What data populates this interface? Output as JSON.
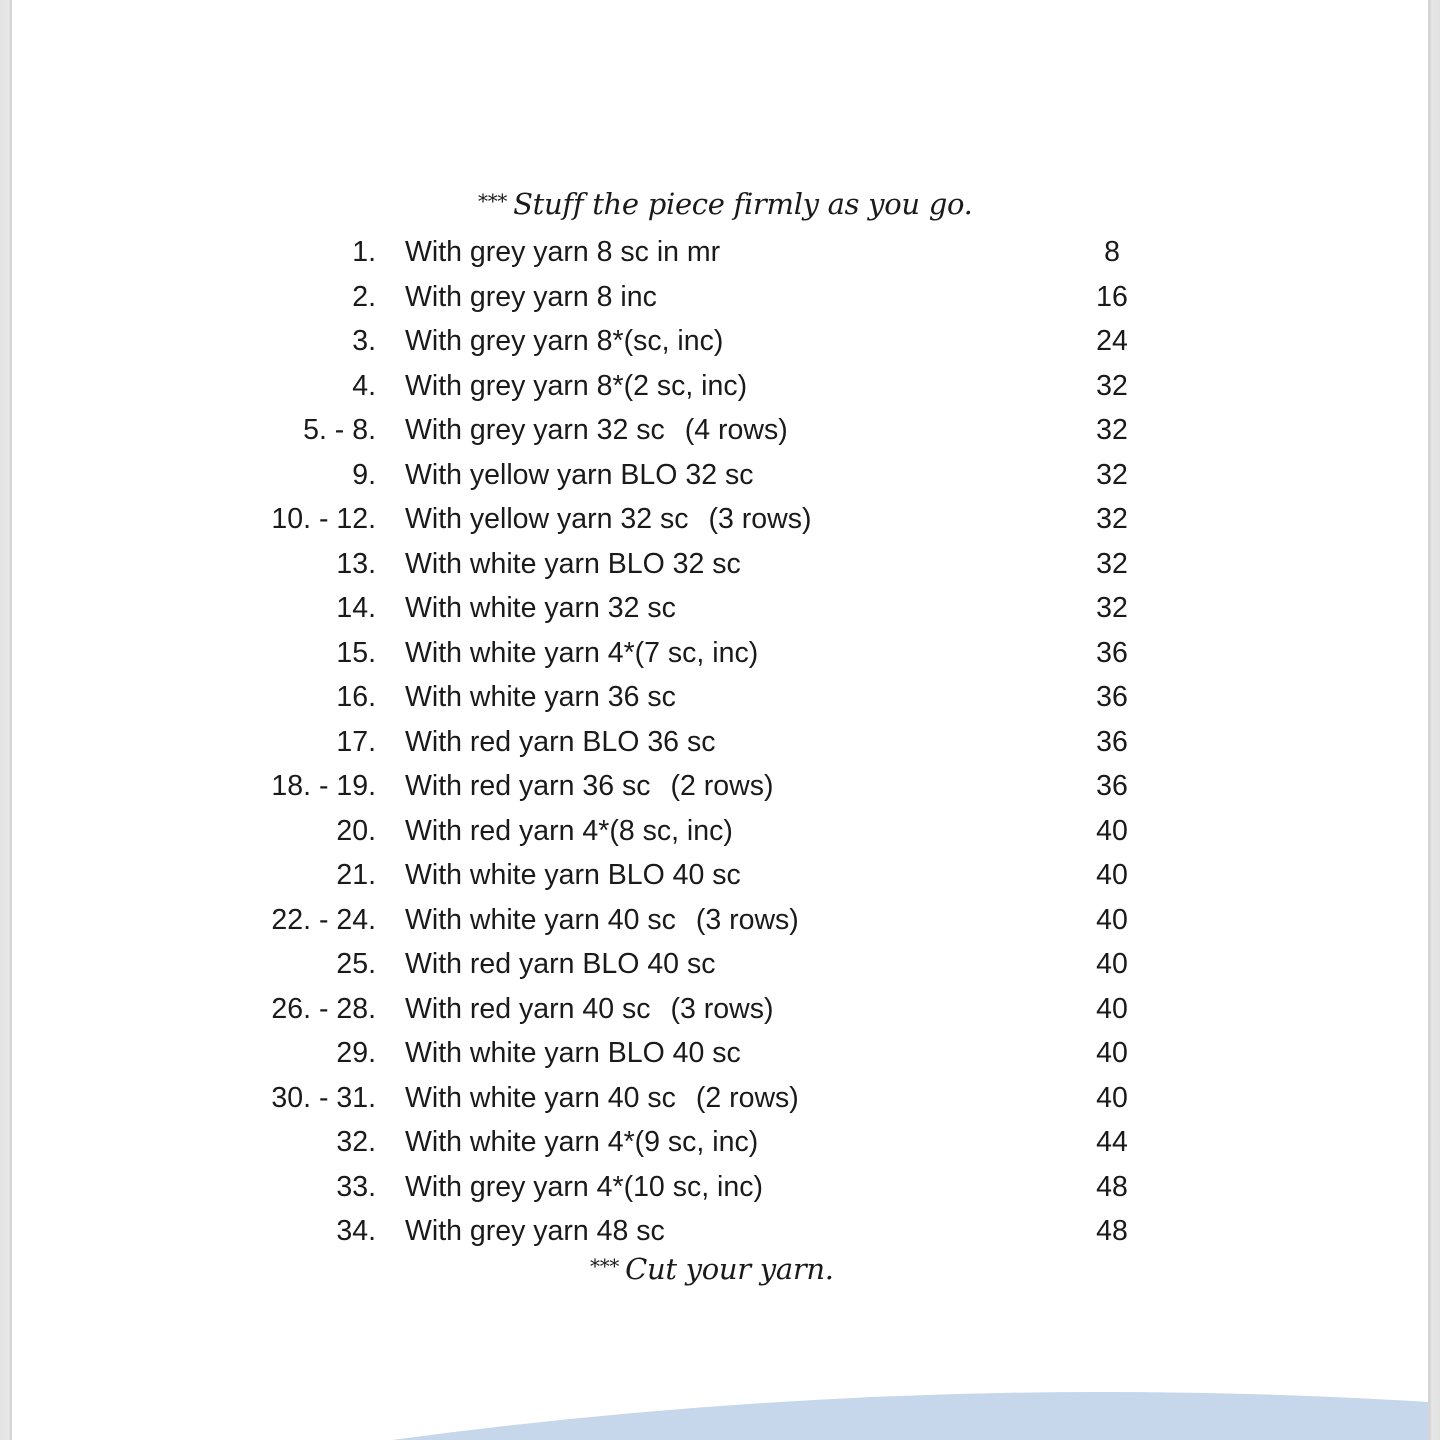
{
  "document": {
    "top_note": {
      "stars": "***",
      "text": "Stuff the piece firmly as you go."
    },
    "bottom_note": {
      "stars": "***",
      "text": "Cut your yarn."
    },
    "rows": [
      {
        "num": "1.",
        "text": "With grey yarn 8 sc in mr",
        "extra": "",
        "count": "8"
      },
      {
        "num": "2.",
        "text": "With grey yarn 8 inc",
        "extra": "",
        "count": "16"
      },
      {
        "num": "3.",
        "text": "With grey yarn 8*(sc, inc)",
        "extra": "",
        "count": "24"
      },
      {
        "num": "4.",
        "text": "With grey yarn 8*(2 sc, inc)",
        "extra": "",
        "count": "32"
      },
      {
        "num": "5. - 8.",
        "text": "With grey yarn 32 sc",
        "extra": "(4 rows)",
        "count": "32"
      },
      {
        "num": "9.",
        "text": "With yellow yarn BLO 32 sc",
        "extra": "",
        "count": "32"
      },
      {
        "num": "10. - 12.",
        "text": "With yellow yarn 32 sc",
        "extra": "(3 rows)",
        "count": "32"
      },
      {
        "num": "13.",
        "text": "With white yarn BLO 32 sc",
        "extra": "",
        "count": "32"
      },
      {
        "num": "14.",
        "text": "With white yarn 32 sc",
        "extra": "",
        "count": "32"
      },
      {
        "num": "15.",
        "text": "With white yarn 4*(7 sc, inc)",
        "extra": "",
        "count": "36"
      },
      {
        "num": "16.",
        "text": "With white yarn 36 sc",
        "extra": "",
        "count": "36"
      },
      {
        "num": "17.",
        "text": "With red yarn BLO 36 sc",
        "extra": "",
        "count": "36"
      },
      {
        "num": "18. - 19.",
        "text": "With red yarn 36 sc",
        "extra": "(2 rows)",
        "count": "36"
      },
      {
        "num": "20.",
        "text": "With red yarn 4*(8 sc, inc)",
        "extra": "",
        "count": "40"
      },
      {
        "num": "21.",
        "text": "With white yarn BLO 40 sc",
        "extra": "",
        "count": "40"
      },
      {
        "num": "22. - 24.",
        "text": "With white yarn 40 sc",
        "extra": "(3 rows)",
        "count": "40"
      },
      {
        "num": "25.",
        "text": "With red yarn BLO 40 sc",
        "extra": "",
        "count": "40"
      },
      {
        "num": "26. - 28.",
        "text": "With red yarn 40 sc",
        "extra": "(3 rows)",
        "count": "40"
      },
      {
        "num": "29.",
        "text": "With white yarn BLO 40 sc",
        "extra": "",
        "count": "40"
      },
      {
        "num": "30. - 31.",
        "text": "With white yarn 40 sc",
        "extra": "(2 rows)",
        "count": "40"
      },
      {
        "num": "32.",
        "text": "With white yarn 4*(9 sc, inc)",
        "extra": "",
        "count": "44"
      },
      {
        "num": "33.",
        "text": "With grey yarn 4*(10 sc, inc)",
        "extra": "",
        "count": "48"
      },
      {
        "num": "34.",
        "text": "With grey yarn 48 sc",
        "extra": "",
        "count": "48"
      }
    ]
  },
  "colors": {
    "page_background": "#ffffff",
    "viewer_background": "#dcdcdc",
    "footer_wave": "#c6d7eb",
    "text": "#1a1a1a"
  }
}
